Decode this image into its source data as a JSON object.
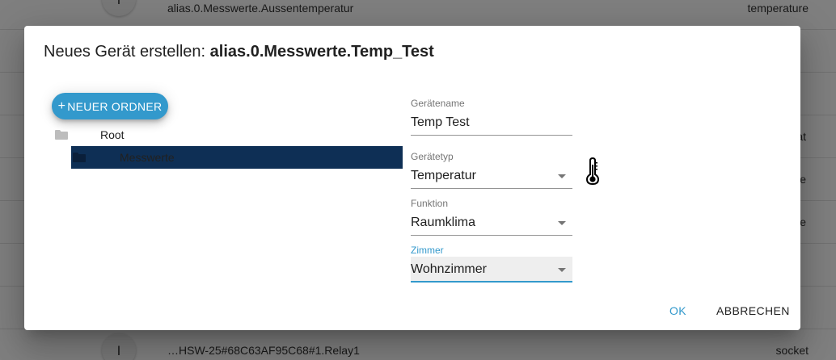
{
  "background_list": {
    "rows": [
      {
        "name": "alias.0.Messwerte.Aussentemperatur",
        "type": "temperature",
        "icon": "I"
      },
      {
        "name": "",
        "type": "",
        "icon": ""
      },
      {
        "name": "",
        "type": "",
        "icon": ""
      },
      {
        "name": "",
        "type": "at",
        "icon": ""
      },
      {
        "name": "",
        "type": "ure",
        "icon": ""
      },
      {
        "name": "",
        "type": "ure",
        "icon": ""
      },
      {
        "name": "",
        "type": "",
        "icon": ""
      },
      {
        "name": "…HSW-25#68C63AF95C68#1.Relay1",
        "type": "socket",
        "icon": "I"
      }
    ]
  },
  "dialog": {
    "title_prefix": "Neues Gerät erstellen: ",
    "title_id": "alias.0.Messwerte.Temp_Test",
    "new_folder_plus": "+",
    "new_folder_label": "NEUER ORDNER",
    "tree": {
      "root_label": "Root",
      "selected_label": "Messwerte"
    },
    "form": {
      "device_name": {
        "label": "Gerätename",
        "value": "Temp Test"
      },
      "device_type": {
        "label": "Gerätetyp",
        "value": "Temperatur"
      },
      "function": {
        "label": "Funktion",
        "value": "Raumklima"
      },
      "room": {
        "label": "Zimmer",
        "value": "Wohnzimmer"
      }
    },
    "device_icon": "thermometer-icon",
    "ok_label": "OK",
    "cancel_label": "ABBRECHEN"
  },
  "colors": {
    "accent": "#3399cc",
    "tree_selected_bg": "#0e2f55",
    "overlay": "rgba(0,0,0,0.5)"
  }
}
